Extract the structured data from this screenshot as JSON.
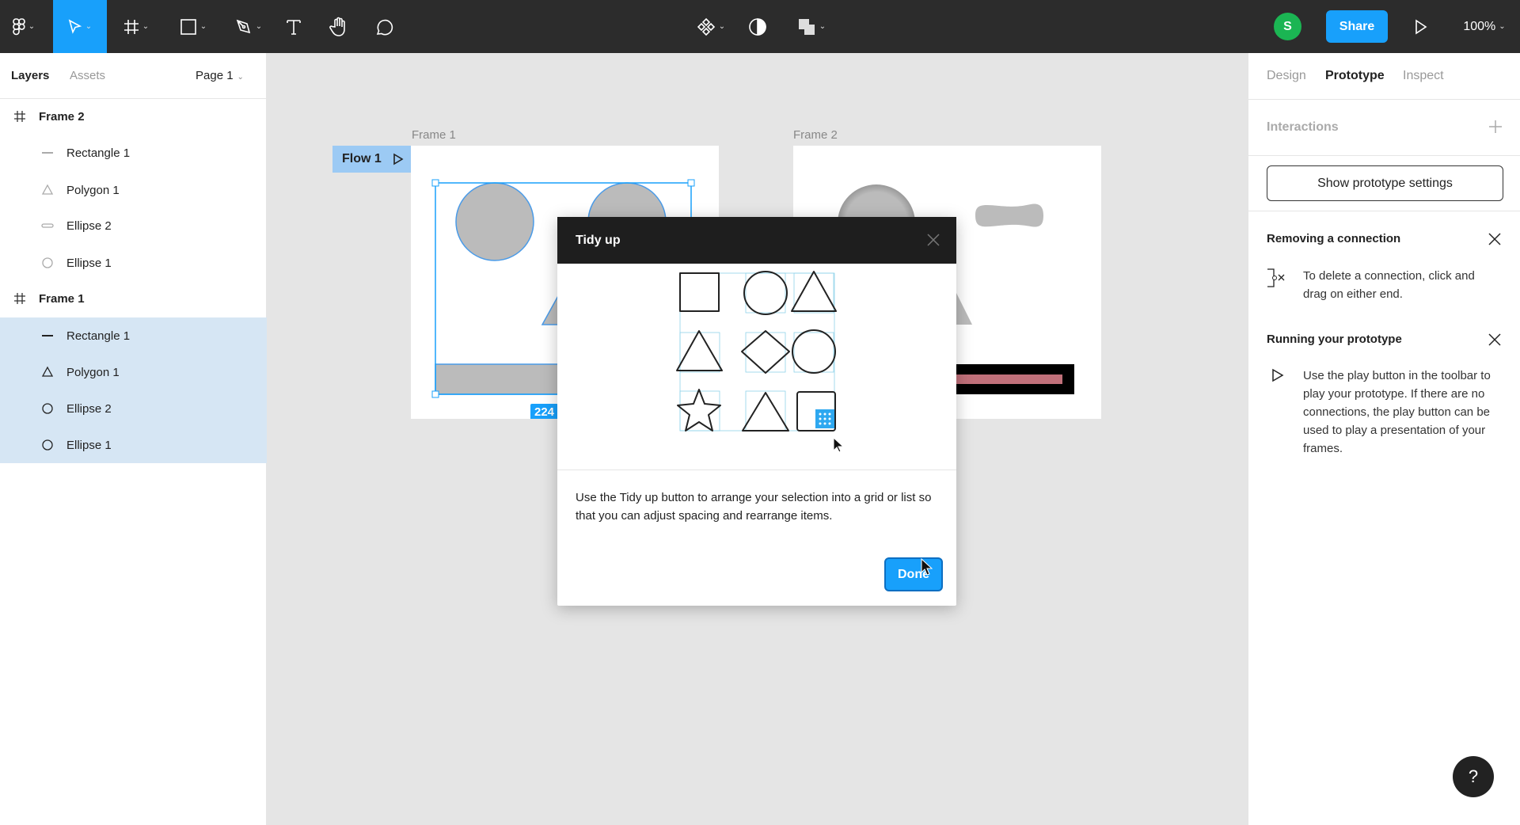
{
  "toolbar": {
    "tools": [
      {
        "name": "main-menu",
        "icon": "figma-logo-icon"
      },
      {
        "name": "move",
        "icon": "move-pointer-icon",
        "active": true
      },
      {
        "name": "frame",
        "icon": "frame-hash-icon"
      },
      {
        "name": "shape",
        "icon": "rectangle-icon"
      },
      {
        "name": "pen",
        "icon": "pen-icon"
      },
      {
        "name": "text",
        "icon": "text-icon"
      },
      {
        "name": "hand",
        "icon": "hand-icon"
      },
      {
        "name": "comment",
        "icon": "comment-icon"
      }
    ],
    "avatar_initial": "S",
    "avatar_color": "#1bb553",
    "share_label": "Share",
    "zoom_level": "100%",
    "accent": "#18a0fb"
  },
  "left_panel": {
    "tabs": [
      "Layers",
      "Assets"
    ],
    "page": "Page 1",
    "layers": [
      {
        "label": "Frame 2",
        "type": "frame",
        "selected": false
      },
      {
        "label": "Rectangle 1",
        "type": "rectangle",
        "selected": false
      },
      {
        "label": "Polygon 1",
        "type": "polygon",
        "selected": false
      },
      {
        "label": "Ellipse 2",
        "type": "ellipse-flat",
        "selected": false
      },
      {
        "label": "Ellipse 1",
        "type": "ellipse",
        "selected": false
      },
      {
        "label": "Frame 1",
        "type": "frame",
        "selected": false
      },
      {
        "label": "Rectangle 1",
        "type": "rectangle",
        "selected": true
      },
      {
        "label": "Polygon 1",
        "type": "polygon",
        "selected": true
      },
      {
        "label": "Ellipse 2",
        "type": "ellipse",
        "selected": true
      },
      {
        "label": "Ellipse 1",
        "type": "ellipse",
        "selected": true
      }
    ]
  },
  "canvas": {
    "frame1_label": "Frame 1",
    "frame2_label": "Frame 2",
    "flow_label": "Flow 1",
    "dimension_badge": "224"
  },
  "dialog": {
    "title": "Tidy up",
    "description": "Use the Tidy up button to arrange your selection into a grid or list so that you can adjust spacing and rearrange items.",
    "done_label": "Done"
  },
  "right_panel": {
    "tabs": [
      "Design",
      "Prototype",
      "Inspect"
    ],
    "active_tab": "Prototype",
    "interactions_label": "Interactions",
    "settings_button": "Show prototype settings",
    "tips": [
      {
        "title": "Removing a connection",
        "text": "To delete a connection, click and drag on either end.",
        "icon": "disconnect-icon"
      },
      {
        "title": "Running your prototype",
        "text": "Use the play button in the toolbar to play your prototype. If there are no connections, the play button can be used to play a presentation of your frames.",
        "icon": "play-icon"
      }
    ]
  },
  "help_label": "?"
}
